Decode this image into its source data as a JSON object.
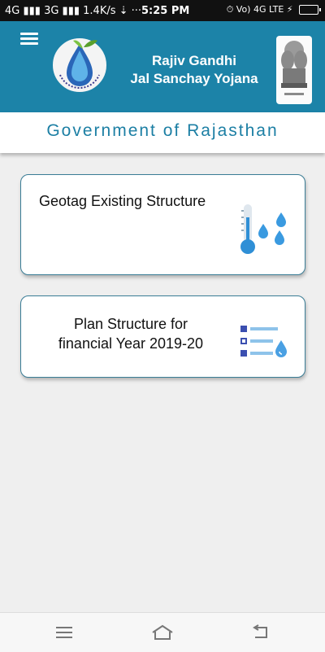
{
  "status_bar": {
    "left_text": "4G ▮▮▮ 3G ▮▮▮ 1.4K/s  ⇣  ···",
    "time": "5:25 PM",
    "right_text": "⏱ Vo) 4G LTE ⚡"
  },
  "header": {
    "title_line1": "Rajiv Gandhi",
    "title_line2": "Jal Sanchay Yojana",
    "menu_icon": "hamburger-menu-icon",
    "logo": "water-drop-logo",
    "emblem": "state-emblem",
    "accent_color": "#1c83a8"
  },
  "subheader": {
    "text": "Government of Rajasthan",
    "color": "#1c7fa4"
  },
  "cards": [
    {
      "title": "Geotag Existing Structure",
      "icon": "thermometer-drops-icon"
    },
    {
      "title_line1": "Plan Structure for",
      "title_line2": "financial Year 2019-20",
      "icon": "list-drop-icon"
    }
  ],
  "nav_bar": {
    "menu_icon": "menu-lines-icon",
    "home_icon": "home-icon",
    "back_icon": "back-icon"
  }
}
